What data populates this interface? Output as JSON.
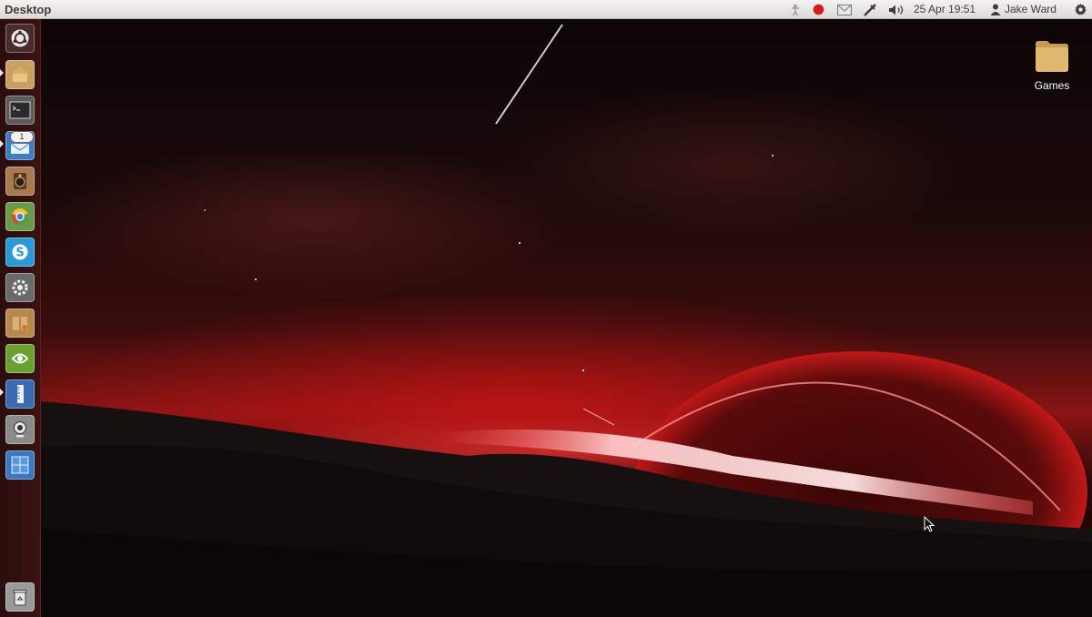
{
  "top_panel": {
    "window_title": "Desktop",
    "clock": "25 Apr 19:51",
    "user": "Jake Ward",
    "record_color": "#d61a1a"
  },
  "launcher": {
    "items": [
      {
        "name": "dash-home",
        "icon": "ubuntu-logo-icon"
      },
      {
        "name": "home-folder",
        "icon": "home-folder-icon"
      },
      {
        "name": "terminal",
        "icon": "terminal-icon"
      },
      {
        "name": "email-client",
        "icon": "email-icon",
        "badge": "1"
      },
      {
        "name": "audio-recorder",
        "icon": "speaker-icon"
      },
      {
        "name": "chromium",
        "icon": "chromium-icon"
      },
      {
        "name": "skype",
        "icon": "skype-icon"
      },
      {
        "name": "system-settings",
        "icon": "settings-icon"
      },
      {
        "name": "archive-manager",
        "icon": "package-icon"
      },
      {
        "name": "nvidia-settings",
        "icon": "nvidia-icon"
      },
      {
        "name": "text-editor",
        "icon": "ruler-icon"
      },
      {
        "name": "webcam",
        "icon": "webcam-icon"
      },
      {
        "name": "workspace-switcher",
        "icon": "workspace-icon"
      },
      {
        "name": "trash",
        "icon": "trash-icon"
      }
    ]
  },
  "desktop": {
    "icons": [
      {
        "label": "Games",
        "icon": "folder-icon"
      }
    ]
  }
}
